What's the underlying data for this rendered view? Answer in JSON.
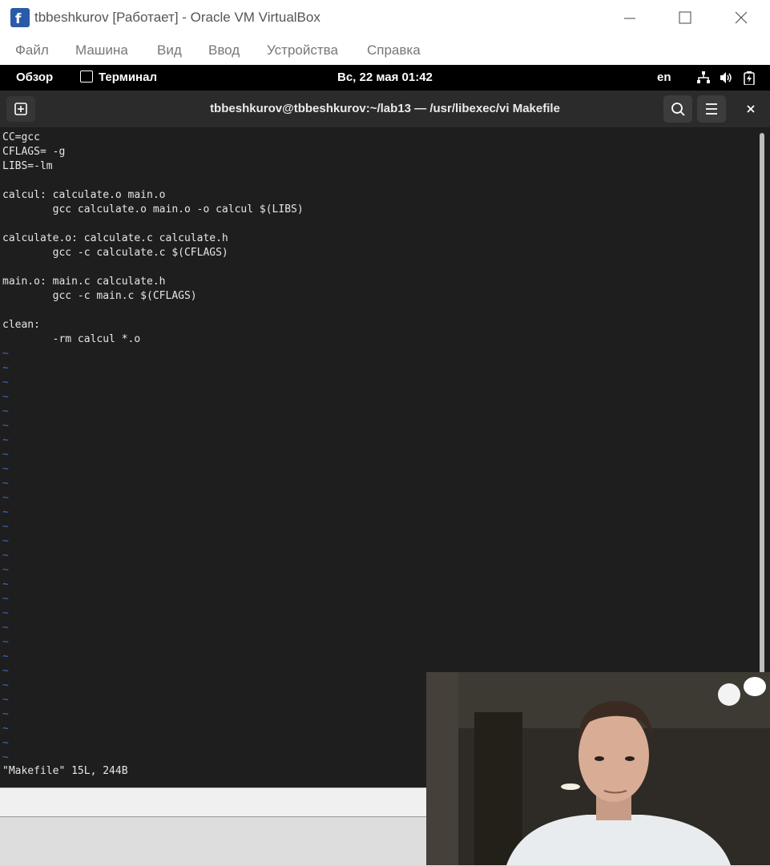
{
  "host": {
    "title": "tbbeshkurov [Работает] - Oracle VM VirtualBox",
    "menu": [
      "Файл",
      "Машина",
      "Вид",
      "Ввод",
      "Устройства",
      "Справка"
    ]
  },
  "gnome": {
    "overview": "Обзор",
    "app_name": "Терминал",
    "clock": "Вс, 22 мая  01:42",
    "lang": "en"
  },
  "terminal": {
    "title": "tbbeshkurov@tbbeshkurov:~/lab13 — /usr/libexec/vi Makefile",
    "content": "CC=gcc\nCFLAGS= -g\nLIBS=-lm\n\ncalcul: calculate.o main.o\n        gcc calculate.o main.o -o calcul $(LIBS)\n\ncalculate.o: calculate.c calculate.h\n        gcc -c calculate.c $(CFLAGS)\n\nmain.o: main.c calculate.h\n        gcc -c main.c $(CFLAGS)\n\nclean:\n        -rm calcul *.o",
    "tildes": "~\n~\n~\n~\n~\n~\n~\n~\n~\n~\n~\n~\n~\n~\n~\n~\n~\n~\n~\n~\n~\n~\n~\n~\n~\n~\n~\n~\n~",
    "status": "\"Makefile\" 15L, 244B"
  },
  "colors": {
    "tilde": "#3b6fc4",
    "terminal_bg": "#1e1e1e",
    "headerbar_bg": "#2b2b2b"
  }
}
